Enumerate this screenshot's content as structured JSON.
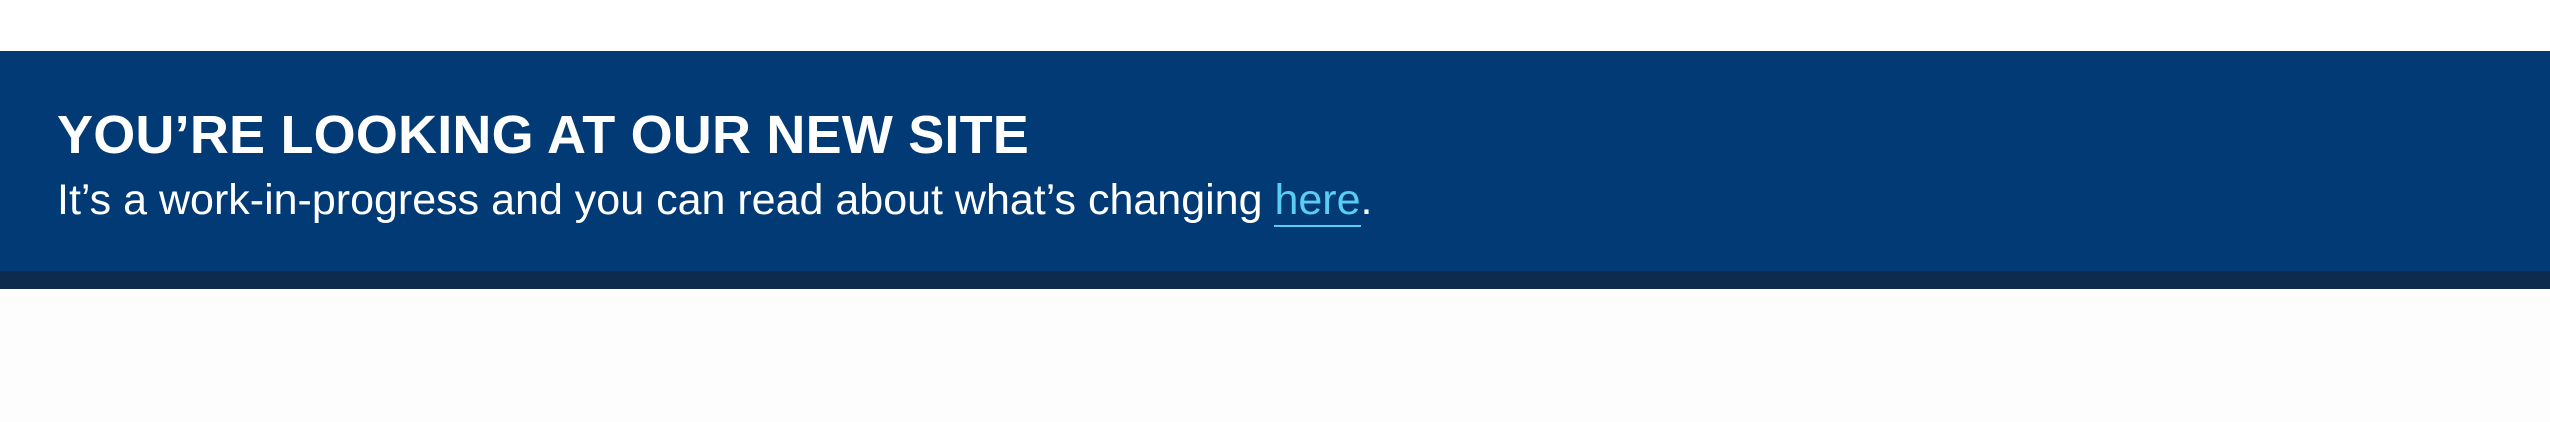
{
  "banner": {
    "title": "YOU’RE LOOKING AT OUR NEW SITE",
    "message_prefix": "It’s a work-in-progress and you can read about what’s changing ",
    "link_text": "here",
    "message_suffix": ".",
    "colors": {
      "background": "#013a74",
      "bottom_border": "#0e2b4d",
      "text": "#ffffff",
      "link": "#5bcdf5"
    }
  }
}
